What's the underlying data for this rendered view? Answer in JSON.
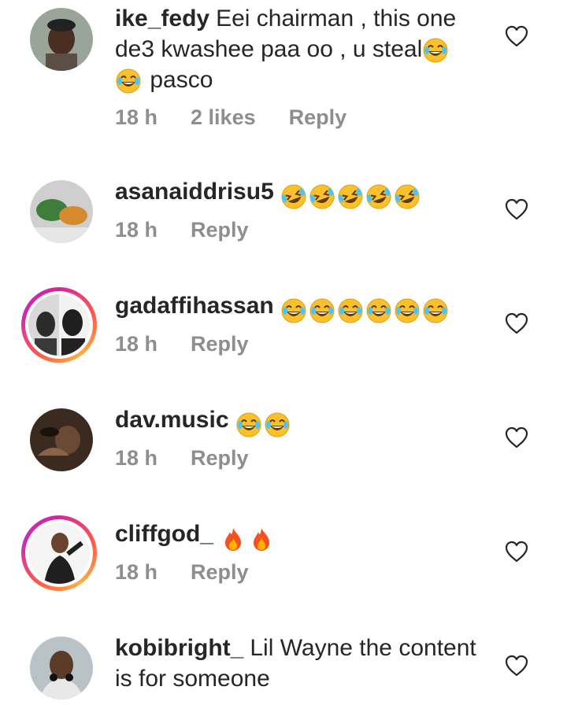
{
  "comments": [
    {
      "username": "ike_fedy",
      "text": "Eei chairman , this one de3 kwashee paa oo , u steal",
      "text_after": "pasco",
      "emoji": [
        "joy",
        "joy"
      ],
      "time": "18 h",
      "likes": "2 likes",
      "reply": "Reply"
    },
    {
      "username": "asanaiddrisu5",
      "text": "",
      "emoji": [
        "rofl",
        "rofl",
        "rofl",
        "rofl",
        "rofl"
      ],
      "time": "18 h",
      "reply": "Reply"
    },
    {
      "username": "gadaffihassan",
      "text": "",
      "emoji": [
        "joy",
        "joy",
        "joy",
        "joy",
        "joy",
        "joy"
      ],
      "time": "18 h",
      "reply": "Reply"
    },
    {
      "username": "dav.music",
      "text": "",
      "emoji": [
        "joy",
        "joy"
      ],
      "time": "18 h",
      "reply": "Reply"
    },
    {
      "username": "cliffgod_",
      "text": "",
      "emoji": [
        "fire",
        "fire"
      ],
      "time": "18 h",
      "reply": "Reply"
    },
    {
      "username": "kobibright_",
      "text": "Lil Wayne the content is for someone",
      "emoji": []
    }
  ],
  "icons": {
    "like": "heart-outline-icon"
  },
  "colors": {
    "text": "#262626",
    "meta": "#8e8e8e",
    "story_ring": "#d6249f"
  }
}
